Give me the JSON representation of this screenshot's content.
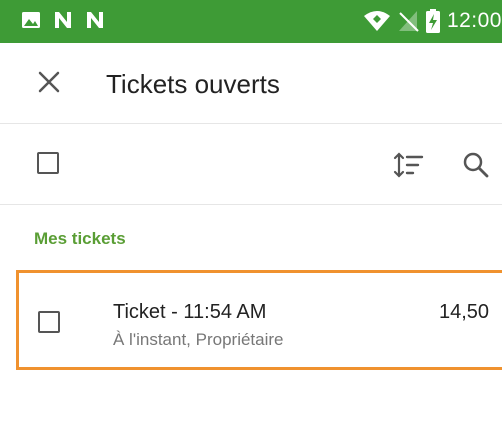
{
  "status_bar": {
    "time": "12:00",
    "icons": [
      "image-icon",
      "n-notification-icon",
      "n-notification-icon",
      "wifi-icon",
      "no-signal-icon",
      "battery-charging-icon"
    ]
  },
  "app_bar": {
    "title": "Tickets ouverts",
    "close_icon": "close-icon"
  },
  "toolbar": {
    "select_all_icon": "checkbox-icon",
    "sort_icon": "sort-icon",
    "search_icon": "search-icon"
  },
  "section": {
    "label": "Mes tickets"
  },
  "tickets": [
    {
      "title": "Ticket - 11:54 AM",
      "subtitle_time": "À l'instant",
      "subtitle_owner": "Propriétaire",
      "amount": "14,50"
    }
  ],
  "colors": {
    "status_bar": "#3e9b36",
    "section_label": "#5a9e35",
    "highlight_border": "#f0922e"
  }
}
